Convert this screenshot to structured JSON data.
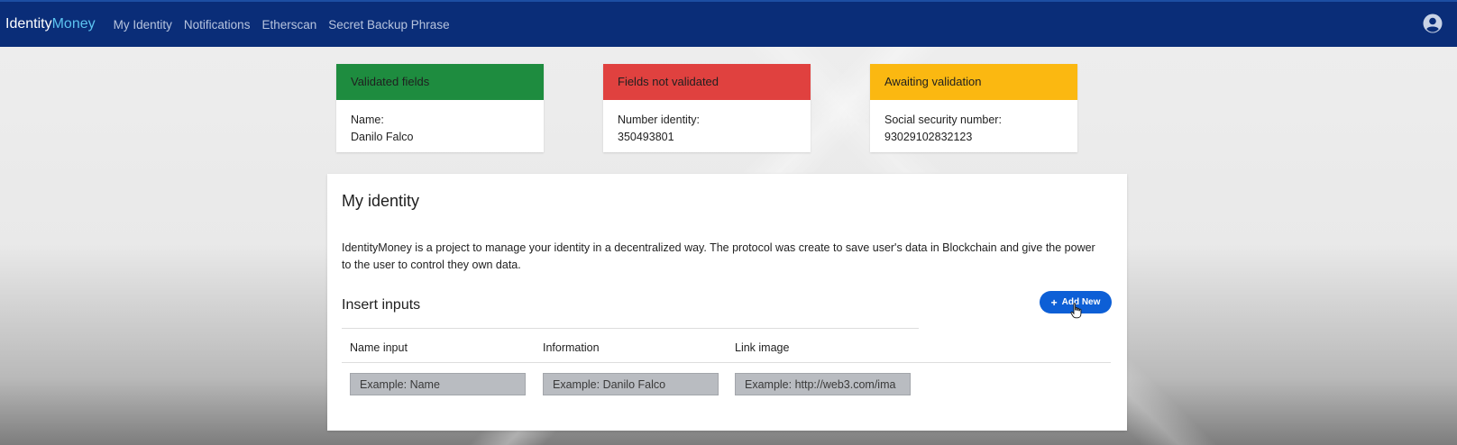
{
  "navbar": {
    "brand_part1": "Identity",
    "brand_part2": "Money",
    "links": [
      "My Identity",
      "Notifications",
      "Etherscan",
      "Secret Backup Phrase"
    ],
    "icon": "user-circle-icon"
  },
  "status_cards": [
    {
      "title": "Validated fields",
      "label": "Name:",
      "value": "Danilo Falco",
      "color": "#1e8c3f"
    },
    {
      "title": "Fields not validated",
      "label": "Number identity:",
      "value": "350493801",
      "color": "#e0413f"
    },
    {
      "title": "Awaiting validation",
      "label": "Social security number:",
      "value": "93029102832123",
      "color": "#fbb811"
    }
  ],
  "main": {
    "title": "My identity",
    "description": "IdentityMoney is a project to manage your identity in a decentralized way. The protocol was create to save user's data in Blockchain and give the power to the user to control they own data.",
    "subtitle": "Insert inputs",
    "add_button": "Add New",
    "table": {
      "headers": [
        "Name input",
        "Information",
        "Link image"
      ],
      "placeholders": [
        "Example: Name",
        "Example: Danilo Falco",
        "Example: http://web3.com/ima"
      ]
    }
  }
}
